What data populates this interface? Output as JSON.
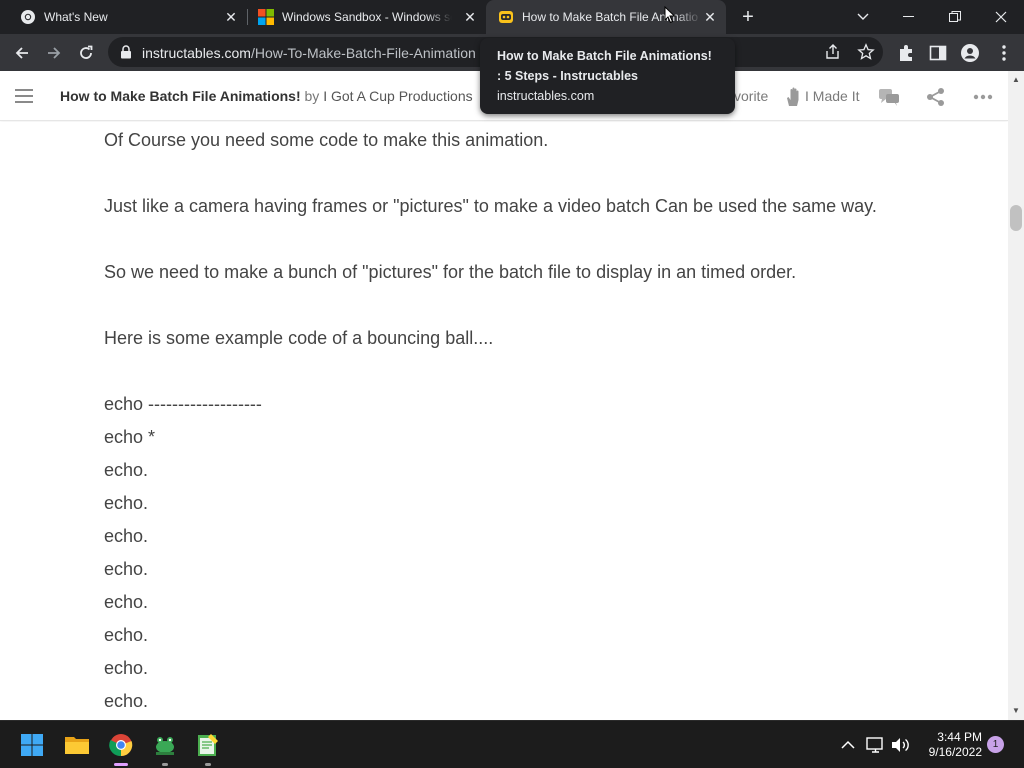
{
  "tabs": [
    {
      "title": "What's New",
      "icon": "chrome-icon"
    },
    {
      "title": "Windows Sandbox - Windows se",
      "icon": "windows-logo-icon"
    },
    {
      "title": "How to Make Batch File Animatio",
      "icon": "instructables-robot-icon",
      "active": true
    }
  ],
  "address_bar": {
    "host": "instructables.com",
    "path": "/How-To-Make-Batch-File-Animation"
  },
  "tooltip": {
    "title": "How to Make Batch File Animations! : 5 Steps - Instructables",
    "host": "instructables.com"
  },
  "site_header": {
    "project_title": "How to Make Batch File Animations!",
    "by": "by",
    "author": "I Got A Cup Productions",
    "favorite_label": "vorite",
    "made_it_label": "I Made It"
  },
  "content": {
    "paragraphs": [
      "Of Course you need some code to make this animation.",
      "Just like a camera having frames or \"pictures\" to make a video batch Can be used the same way.",
      "So we need to make a bunch of \"pictures\" for the batch file to display in an timed order.",
      "Here is some example code of a bouncing ball...."
    ],
    "code_lines": [
      "echo -------------------",
      "echo *",
      "echo.",
      "echo.",
      "echo.",
      "echo.",
      "echo.",
      "echo.",
      "echo.",
      "echo."
    ]
  },
  "taskbar": {
    "time": "3:44 PM",
    "date": "9/16/2022",
    "notification_count": "1"
  },
  "colors": {
    "tabstrip_bg": "#202124",
    "toolbar_bg": "#35363a",
    "taskbar_bg": "#1c1c1c",
    "text": "#444444",
    "active_indicator": "#e0a0ff"
  }
}
